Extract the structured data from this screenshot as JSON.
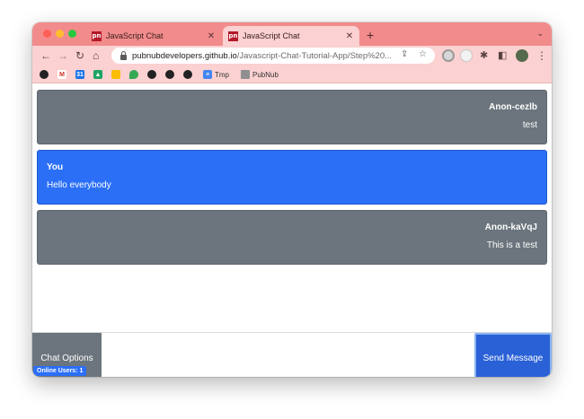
{
  "browser": {
    "tabs": [
      {
        "title": "JavaScript Chat",
        "favicon": "pn",
        "active": false
      },
      {
        "title": "JavaScript Chat",
        "favicon": "pn",
        "active": true
      }
    ],
    "new_tab": "+",
    "url_host": "pubnubdevelopers.github.io",
    "url_path": "/Javascript-Chat-Tutorial-App/Step%20...",
    "bookmarks": [
      {
        "label": "",
        "icon": "github-icon"
      },
      {
        "label": "",
        "icon": "gmail-icon"
      },
      {
        "label": "",
        "icon": "calendar-icon"
      },
      {
        "label": "",
        "icon": "drive-icon"
      },
      {
        "label": "",
        "icon": "keep-icon"
      },
      {
        "label": "",
        "icon": "maps-icon"
      },
      {
        "label": "",
        "icon": "github-icon"
      },
      {
        "label": "",
        "icon": "github-icon"
      },
      {
        "label": "",
        "icon": "github-icon"
      },
      {
        "label": "Tmp",
        "icon": "docs-icon"
      },
      {
        "label": "PubNub",
        "icon": "folder-icon"
      }
    ],
    "colors": {
      "tabstrip": "#f28b8b",
      "toolbar": "#fbd1d1"
    }
  },
  "chat": {
    "messages": [
      {
        "sender": "Anon-cezlb",
        "text": "test",
        "self": false
      },
      {
        "sender": "You",
        "text": "Hello everybody",
        "self": true
      },
      {
        "sender": "Anon-kaVqJ",
        "text": "This is a test",
        "self": false
      }
    ],
    "options_label": "Chat Options",
    "input_value": "",
    "input_placeholder": "",
    "send_label": "Send Message",
    "online_label": "Online Users: 1",
    "colors": {
      "other": "#6c757d",
      "self": "#2b6ff6",
      "send": "#2a61d6"
    }
  }
}
